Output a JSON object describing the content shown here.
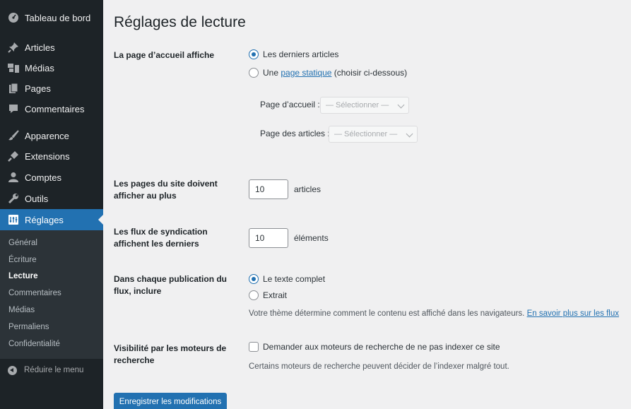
{
  "sidebar": {
    "items": [
      {
        "label": "Tableau de bord",
        "icon": "dashboard-icon"
      },
      {
        "label": "Articles",
        "icon": "pin-icon"
      },
      {
        "label": "Médias",
        "icon": "media-icon"
      },
      {
        "label": "Pages",
        "icon": "pages-icon"
      },
      {
        "label": "Commentaires",
        "icon": "comment-icon"
      },
      {
        "label": "Apparence",
        "icon": "brush-icon"
      },
      {
        "label": "Extensions",
        "icon": "plugin-icon"
      },
      {
        "label": "Comptes",
        "icon": "user-icon"
      },
      {
        "label": "Outils",
        "icon": "wrench-icon"
      },
      {
        "label": "Réglages",
        "icon": "settings-icon"
      }
    ],
    "submenu": [
      "Général",
      "Écriture",
      "Lecture",
      "Commentaires",
      "Médias",
      "Permaliens",
      "Confidentialité"
    ],
    "collapse_label": "Réduire le menu"
  },
  "page": {
    "title": "Réglages de lecture",
    "homepage": {
      "label": "La page d’accueil affiche",
      "option_latest": "Les derniers articles",
      "option_static_prefix": "Une",
      "option_static_link": "page statique",
      "option_static_suffix": "(choisir ci-dessous)",
      "front_label": "Page d’accueil :",
      "posts_label": "Page des articles :",
      "select_placeholder": "— Sélectionner —"
    },
    "posts_per_page": {
      "label": "Les pages du site doivent afficher au plus",
      "value": "10",
      "unit": "articles"
    },
    "feed_count": {
      "label": "Les flux de syndication affichent les derniers",
      "value": "10",
      "unit": "éléments"
    },
    "feed_content": {
      "label": "Dans chaque publication du flux, inclure",
      "option_full": "Le texte complet",
      "option_excerpt": "Extrait",
      "description": "Votre thème détermine comment le contenu est affiché dans les navigateurs.",
      "link": "En savoir plus sur les flux"
    },
    "visibility": {
      "label": "Visibilité par les moteurs de recherche",
      "checkbox_label": "Demander aux moteurs de recherche de ne pas indexer ce site",
      "description": "Certains moteurs de recherche peuvent décider de l’indexer malgré tout."
    },
    "save_label": "Enregistrer les modifications"
  },
  "colors": {
    "sidebar_bg": "#1d2327",
    "accent": "#2271b1",
    "content_bg": "#f0f0f1"
  }
}
